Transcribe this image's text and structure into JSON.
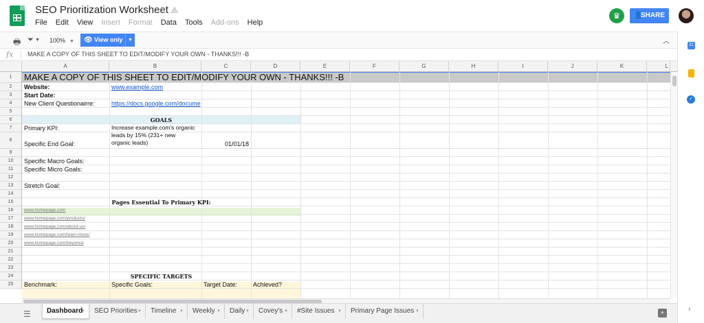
{
  "header": {
    "doc_title": "SEO Prioritization Worksheet",
    "share_label": "SHARE",
    "menus": [
      {
        "label": "File",
        "enabled": true
      },
      {
        "label": "Edit",
        "enabled": true
      },
      {
        "label": "View",
        "enabled": true
      },
      {
        "label": "Insert",
        "enabled": false
      },
      {
        "label": "Format",
        "enabled": false
      },
      {
        "label": "Data",
        "enabled": true
      },
      {
        "label": "Tools",
        "enabled": true
      },
      {
        "label": "Add-ons",
        "enabled": false
      },
      {
        "label": "Help",
        "enabled": true
      }
    ]
  },
  "toolbar": {
    "zoom": "100%",
    "view_only_label": "View only"
  },
  "formula_bar": {
    "fx": "fx",
    "content": "MAKE A COPY OF THIS SHEET TO EDIT/MODIFY YOUR OWN - THANKS!!! -B"
  },
  "grid": {
    "columns": [
      "A",
      "B",
      "C",
      "D",
      "E",
      "F",
      "G",
      "H",
      "I",
      "J",
      "K",
      "L"
    ],
    "rows": [
      "1",
      "2",
      "3",
      "4",
      "5",
      "6",
      "7",
      "8",
      "9",
      "10",
      "11",
      "12",
      "13",
      "14",
      "15",
      "16",
      "17",
      "18",
      "19",
      "20",
      "21",
      "22",
      "23",
      "24",
      "25"
    ],
    "banner": "MAKE A COPY OF THIS SHEET TO EDIT/MODIFY YOUR OWN - THANKS!!! -B",
    "website_label": "Website:",
    "website_value": "www.example.com",
    "start_date_label": "Start Date:",
    "questionnaire_label": "New Client Questionairre:",
    "questionnaire_value": "https://docs.google.com/docume",
    "goals_header": "GOALS",
    "primary_kpi_label": "Primary KPI:",
    "end_goal_text_1": "Increase example.com's organic",
    "end_goal_text_2": "leads by 15% (231+ new",
    "end_goal_text_3": "organic leads)",
    "end_goal_label": "Specific End Goal:",
    "end_goal_date": "01/01/18",
    "macro_goals_label": "Specific Macro Goals:",
    "micro_goals_label": "Specific Micro Goals:",
    "stretch_goal_label": "Stretch Goal:",
    "pages_header": "Pages Essential To Primary KPI:",
    "pages": [
      "www.homepage.com",
      "www.homepage.com/products/",
      "www.homepage.com/about-us/",
      "www.homepage.com/learn-more/",
      "www.homepage.com/beyonce"
    ],
    "targets_header": "SPECIFIC TARGETS",
    "benchmark_label": "Benchmark:",
    "specific_goals_label": "Specific Goals:",
    "target_date_label": "Target Date:",
    "achieved_label": "Achieved?"
  },
  "tabs": [
    {
      "label": "Dashboard",
      "active": true
    },
    {
      "label": "SEO Priorities",
      "active": false
    },
    {
      "label": "Timeline",
      "active": false
    },
    {
      "label": "Weekly",
      "active": false
    },
    {
      "label": "Daily",
      "active": false
    },
    {
      "label": "Covey's",
      "active": false
    },
    {
      "label": "#Site Issues",
      "active": false
    },
    {
      "label": "Primary Page Issues",
      "active": false
    }
  ],
  "colors": {
    "accent": "#4285f4",
    "sheets_green": "#0f9d58",
    "goals_band": "#dff0f7",
    "pages_band": "#e6f4d8",
    "targets_band": "#fff6dc",
    "banner_band": "#c9c9c9"
  }
}
